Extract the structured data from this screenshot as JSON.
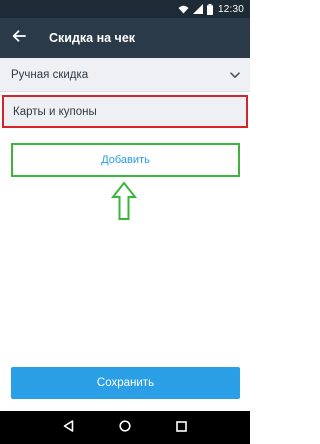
{
  "status_bar": {
    "time": "12:30",
    "icons": [
      "wifi-icon",
      "signal-icon",
      "battery-icon"
    ]
  },
  "app_bar": {
    "title": "Скидка на чек",
    "back_icon": "arrow-left-icon"
  },
  "discount_mode": {
    "label": "Ручная скидка",
    "icon": "chevron-down-icon"
  },
  "cards_row": {
    "label": "Карты и купоны",
    "highlight_color": "#d9232b"
  },
  "add_button": {
    "label": "Добавить",
    "highlight_color": "#3bb63b"
  },
  "annotation": {
    "icon": "arrow-up-icon",
    "color": "#3bb63b"
  },
  "save_button": {
    "label": "Сохранить",
    "color": "#2a9fe6"
  },
  "nav_bar": {
    "icons": [
      "back-triangle-icon",
      "home-circle-icon",
      "recents-square-icon"
    ]
  },
  "colors": {
    "app_bar": "#2b3a48",
    "status_bar": "#1e2b36",
    "accent": "#2a9be0"
  }
}
